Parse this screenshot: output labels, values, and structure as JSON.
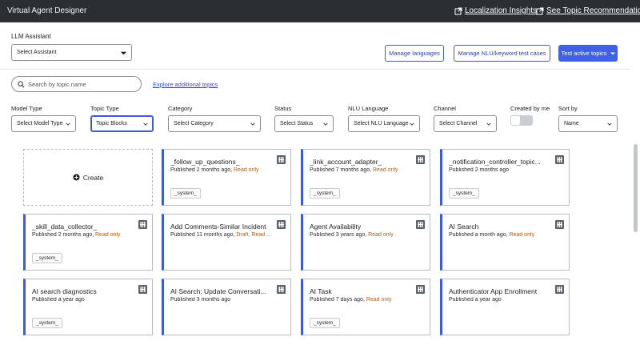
{
  "header": {
    "title": "Virtual Agent Designer",
    "link_insights": "Localization Insights",
    "link_recommendations": "See Topic Recommendations"
  },
  "llm": {
    "label": "LLM Assistant",
    "select_value": "Select Assistant"
  },
  "actions": {
    "manage_languages": "Manage languages",
    "manage_nlu": "Manage NLU/keyword test cases",
    "test_active": "Test active topics"
  },
  "search": {
    "placeholder": "Search by topic name",
    "explore": "Explore additional topics"
  },
  "filters": {
    "model_type": {
      "label": "Model Type",
      "value": "Select Model Type"
    },
    "topic_type": {
      "label": "Topic Type",
      "value": "Topic Blocks"
    },
    "category": {
      "label": "Category",
      "value": "Select Category"
    },
    "status": {
      "label": "Status",
      "value": "Select Status"
    },
    "nlu_language": {
      "label": "NLU Language",
      "value": "Select NLU Language"
    },
    "channel": {
      "label": "Channel",
      "value": "Select Channel"
    },
    "created_by_me": {
      "label": "Created by me",
      "on": false
    },
    "sort_by": {
      "label": "Sort by",
      "value": "Name"
    }
  },
  "create_label": "Create",
  "cards": [
    {
      "title": "_follow_up_questions_",
      "published": "Published 2 months ago, ",
      "flags": "Read only",
      "badge": "_system_"
    },
    {
      "title": "_link_account_adapter_",
      "published": "Published 7 months ago, ",
      "flags": "Read only",
      "badge": "_system_"
    },
    {
      "title": "_notification_controller_topic...",
      "published": "Published 2 months ago",
      "flags": "",
      "badge": "_system_"
    },
    {
      "title": "_skill_data_collector_",
      "published": "Published 2 months ago, ",
      "flags": "Read only",
      "badge": "_system_"
    },
    {
      "title": "Add Comments-Similar Incident",
      "published": "Published 11 months ago, ",
      "flags": "Draft, Read ...",
      "badge": ""
    },
    {
      "title": "Agent Availability",
      "published": "Published 3 years ago, ",
      "flags": "Read only",
      "badge": ""
    },
    {
      "title": "AI Search",
      "published": "Published a month ago, ",
      "flags": "Read only",
      "badge": ""
    },
    {
      "title": "AI search diagnostics",
      "published": "Published a year ago",
      "flags": "",
      "badge": "_system_"
    },
    {
      "title": "AI Search: Update Conversati...",
      "published": "Published 3 months ago",
      "flags": "",
      "badge": ""
    },
    {
      "title": "AI Task",
      "published": "Published 7 days ago, ",
      "flags": "Read only",
      "badge": "_system_"
    },
    {
      "title": "Authenticator App Enrollment",
      "published": "Published a year ago",
      "flags": "",
      "badge": ""
    }
  ],
  "colors": {
    "topbar": "#2b2f33",
    "accent": "#3b5bdb",
    "primary_button": "#4060e6",
    "warning_text": "#c45a00"
  },
  "icons": {
    "external_link": "external-link-icon",
    "search": "search-icon",
    "plus_circle": "plus-circle-icon",
    "card_menu": "topic-grid-icon",
    "chevron": "chevron-down-icon"
  }
}
